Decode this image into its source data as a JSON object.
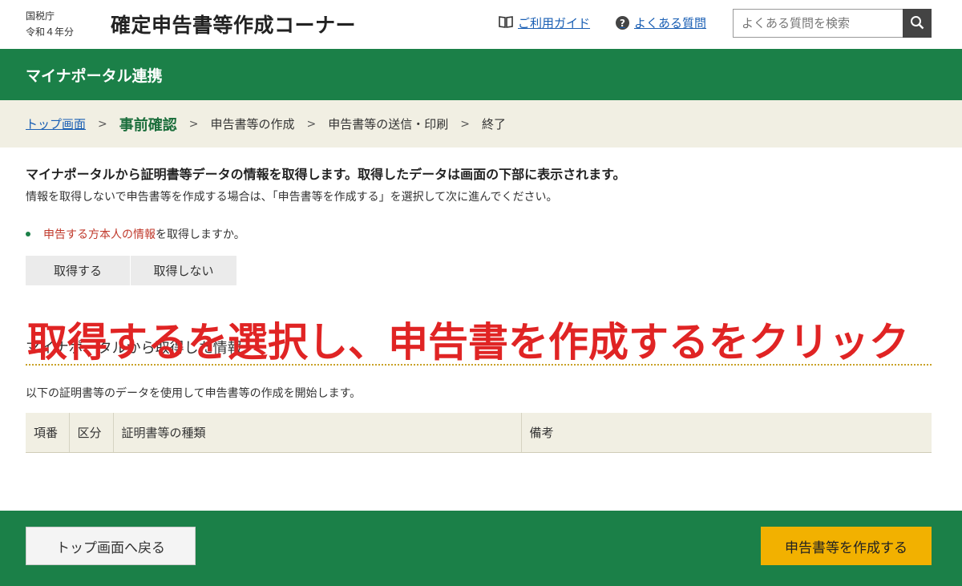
{
  "header": {
    "agency": "国税庁",
    "year": "令和４年分",
    "site_title": "確定申告書等作成コーナー",
    "guide_label": "ご利用ガイド",
    "faq_label": "よくある質問",
    "search_placeholder": "よくある質問を検索"
  },
  "section_bar": {
    "title": "マイナポータル連携"
  },
  "breadcrumb": {
    "steps": [
      "トップ画面",
      "事前確認",
      "申告書等の作成",
      "申告書等の送信・印刷",
      "終了"
    ]
  },
  "main": {
    "lead": "マイナポータルから証明書等データの情報を取得します。取得したデータは画面の下部に表示されます。",
    "sub": "情報を取得しないで申告書等を作成する場合は、「申告書等を作成する」を選択して次に進んでください。",
    "question_link": "申告する方本人の情報",
    "question_rest": "を取得しますか。",
    "choice_yes": "取得する",
    "choice_no": "取得しない",
    "section_title": "マイナポータルから取得した情報",
    "section_text": "以下の証明書等のデータを使用して申告書等の作成を開始します。",
    "table_headers": [
      "項番",
      "区分",
      "証明書等の種類",
      "備考"
    ]
  },
  "overlay": {
    "text": "取得するを選択し、申告書を作成するをクリック"
  },
  "footer": {
    "back_label": "トップ画面へ戻る",
    "create_label": "申告書等を作成する"
  },
  "colors": {
    "brand_green": "#1b8048",
    "accent_yellow": "#f2b100",
    "overlay_red": "#e02424",
    "link_blue": "#1a5fb4"
  }
}
